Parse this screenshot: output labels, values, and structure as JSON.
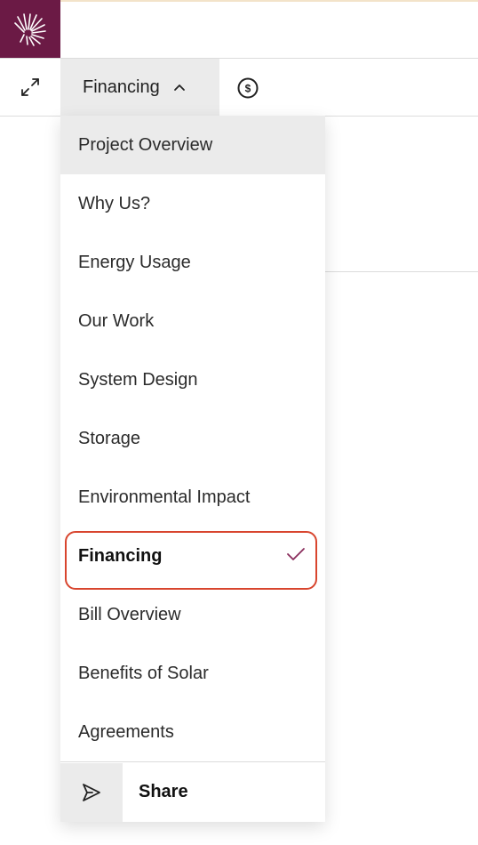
{
  "brand": {
    "logo_icon": "sunburst-logo-icon",
    "color": "#6b1a45"
  },
  "toolbar": {
    "expand_icon": "expand-arrows-icon",
    "current_section": "Financing",
    "chevron_icon": "chevron-up-icon",
    "pricing_icon": "dollar-circle-icon"
  },
  "menu": {
    "items": [
      {
        "label": "Project Overview",
        "state": "hover"
      },
      {
        "label": "Why Us?"
      },
      {
        "label": "Energy Usage"
      },
      {
        "label": "Our Work"
      },
      {
        "label": "System Design"
      },
      {
        "label": "Storage"
      },
      {
        "label": "Environmental Impact"
      },
      {
        "label": "Financing",
        "state": "selected"
      },
      {
        "label": "Bill Overview"
      },
      {
        "label": "Benefits of Solar"
      },
      {
        "label": "Agreements"
      }
    ],
    "selected_icon": "checkmark-icon",
    "accent_color": "#8a2d5c",
    "highlight_color": "#d8452e"
  },
  "share": {
    "label": "Share",
    "icon": "send-icon"
  }
}
